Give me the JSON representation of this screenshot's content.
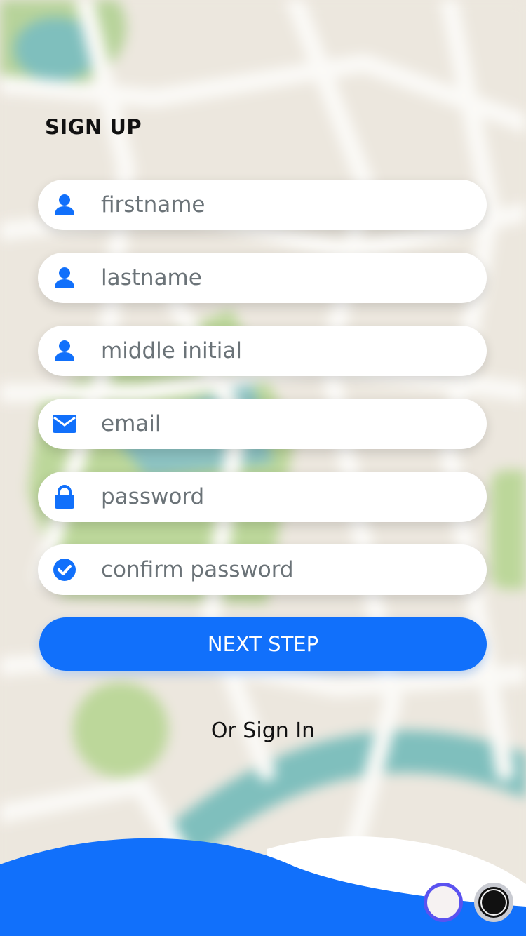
{
  "page": {
    "title": "SIGN UP"
  },
  "form": {
    "fields": [
      {
        "placeholder": "firstname",
        "value": "",
        "icon": "user-icon"
      },
      {
        "placeholder": "lastname",
        "value": "",
        "icon": "user-icon"
      },
      {
        "placeholder": "middle initial",
        "value": "",
        "icon": "user-icon"
      },
      {
        "placeholder": "email",
        "value": "",
        "icon": "envelope-icon"
      },
      {
        "placeholder": "password",
        "value": "",
        "icon": "lock-icon"
      },
      {
        "placeholder": "confirm password",
        "value": "",
        "icon": "check-circle-icon"
      }
    ],
    "next_label": "NEXT STEP",
    "signin_label": "Or Sign In"
  },
  "pager": {
    "page_count": 2,
    "current_page": 2
  },
  "colors": {
    "accent": "#1170fb",
    "background_map": "#ece7de",
    "field_background": "#ffffff",
    "pager_ring_active": "#5b52f0"
  }
}
